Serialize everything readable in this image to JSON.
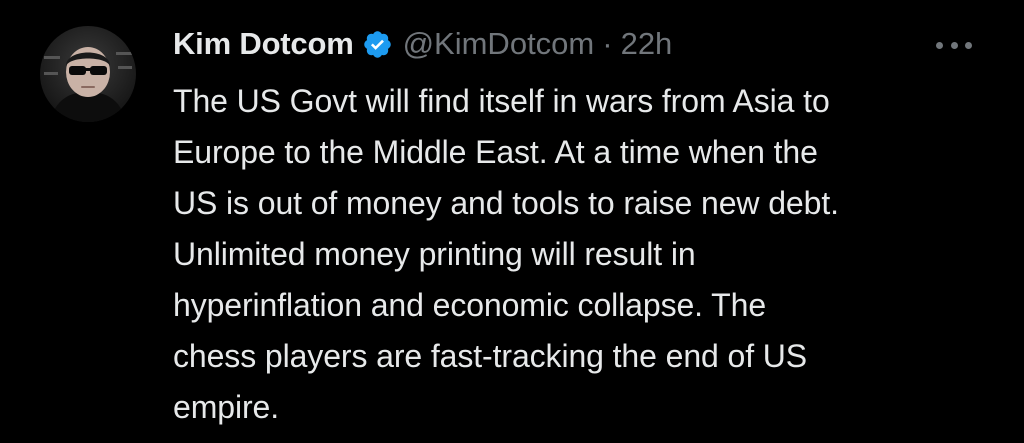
{
  "tweet": {
    "author": {
      "display_name": "Kim Dotcom",
      "handle": "@KimDotcom",
      "verified_icon": "verified-badge-icon",
      "avatar_icon": "avatar-photo"
    },
    "separator": "·",
    "timestamp": "22h",
    "more_icon": "more-options-icon",
    "text_lines": [
      "The US Govt will find itself in wars from Asia to",
      "Europe to the Middle East. At a time when the",
      "US is out of money and tools to raise new debt.",
      "Unlimited money printing will result in",
      "hyperinflation and economic collapse. The",
      "chess players are fast-tracking the end of US",
      "empire."
    ]
  },
  "colors": {
    "background": "#000000",
    "primary_text": "#e7e9ea",
    "secondary_text": "#71767b",
    "verified_blue": "#1d9bf0"
  }
}
